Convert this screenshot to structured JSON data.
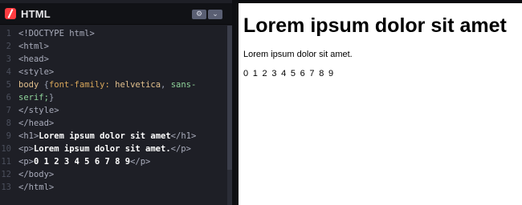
{
  "editor": {
    "tab_label": "HTML",
    "settings_icon": "gear-icon",
    "dropdown_icon": "chevron-down-icon",
    "lines": [
      {
        "num": "1",
        "text": "<!DOCTYPE html>"
      },
      {
        "num": "2",
        "text": "<html>"
      },
      {
        "num": "3",
        "text": "<head>"
      },
      {
        "num": "4",
        "text": "<style>"
      },
      {
        "num": "5",
        "text": "body {font-family: helvetica, sans-"
      },
      {
        "num": "6",
        "text": "serif;}"
      },
      {
        "num": "7",
        "text": "</style>"
      },
      {
        "num": "8",
        "text": "</head>"
      },
      {
        "num": "9",
        "text": "<h1>Lorem ipsum dolor sit amet</h1>"
      },
      {
        "num": "10",
        "text": "<p>Lorem ipsum dolor sit amet.</p>"
      },
      {
        "num": "11",
        "text": "<p>0 1 2 3 4 5 6 7 8 9</p>"
      },
      {
        "num": "12",
        "text": "</body>"
      },
      {
        "num": "13",
        "text": "</html>"
      }
    ]
  },
  "preview": {
    "heading": "Lorem ipsum dolor sit amet",
    "paragraph": "Lorem ipsum dolor sit amet.",
    "numbers": "0 1 2 3 4 5 6 7 8 9"
  },
  "colors": {
    "brand": "#ff3c41",
    "editor_bg": "#1e1f26",
    "header_bg": "#111216",
    "preview_bg": "#ffffff"
  }
}
